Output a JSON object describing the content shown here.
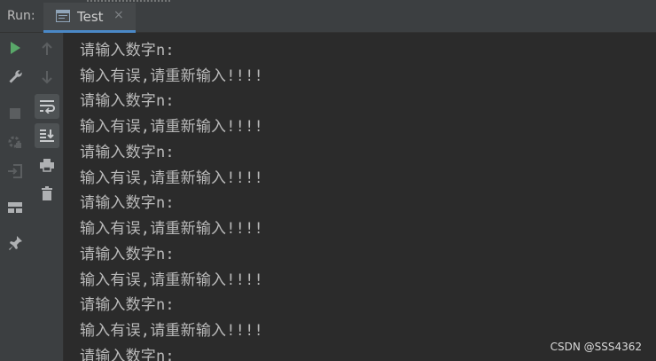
{
  "panel": {
    "run_label": "Run:",
    "tab": {
      "label": "Test",
      "close_glyph": "×",
      "icon": "console-window-icon"
    }
  },
  "left_toolbar": [
    {
      "icon": "run-icon",
      "color": "#59a869"
    },
    {
      "icon": "wrench-icon"
    },
    {
      "icon": "stop-icon"
    },
    {
      "icon": "rerun-settings-icon"
    },
    {
      "icon": "exit-icon"
    },
    {
      "icon": "layout-icon"
    },
    {
      "icon": "pin-icon"
    }
  ],
  "second_toolbar": [
    {
      "icon": "arrow-up-icon"
    },
    {
      "icon": "arrow-down-icon"
    },
    {
      "icon": "soft-wrap-icon",
      "toggled": true
    },
    {
      "icon": "scroll-to-end-icon",
      "toggled": true
    },
    {
      "icon": "print-icon"
    },
    {
      "icon": "trash-icon"
    }
  ],
  "console": {
    "lines": [
      "请输入数字n:",
      "输入有误,请重新输入!!!!",
      "请输入数字n:",
      "输入有误,请重新输入!!!!",
      "请输入数字n:",
      "输入有误,请重新输入!!!!",
      "请输入数字n:",
      "输入有误,请重新输入!!!!",
      "请输入数字n:",
      "输入有误,请重新输入!!!!",
      "请输入数字n:",
      "输入有误,请重新输入!!!!",
      "请输入数字n:"
    ]
  },
  "watermark": "CSDN @SSS4362",
  "colors": {
    "background": "#2b2b2b",
    "toolbar": "#3c3f41",
    "accent": "#4a88c7",
    "text": "#bababa",
    "run_green": "#59a869"
  }
}
